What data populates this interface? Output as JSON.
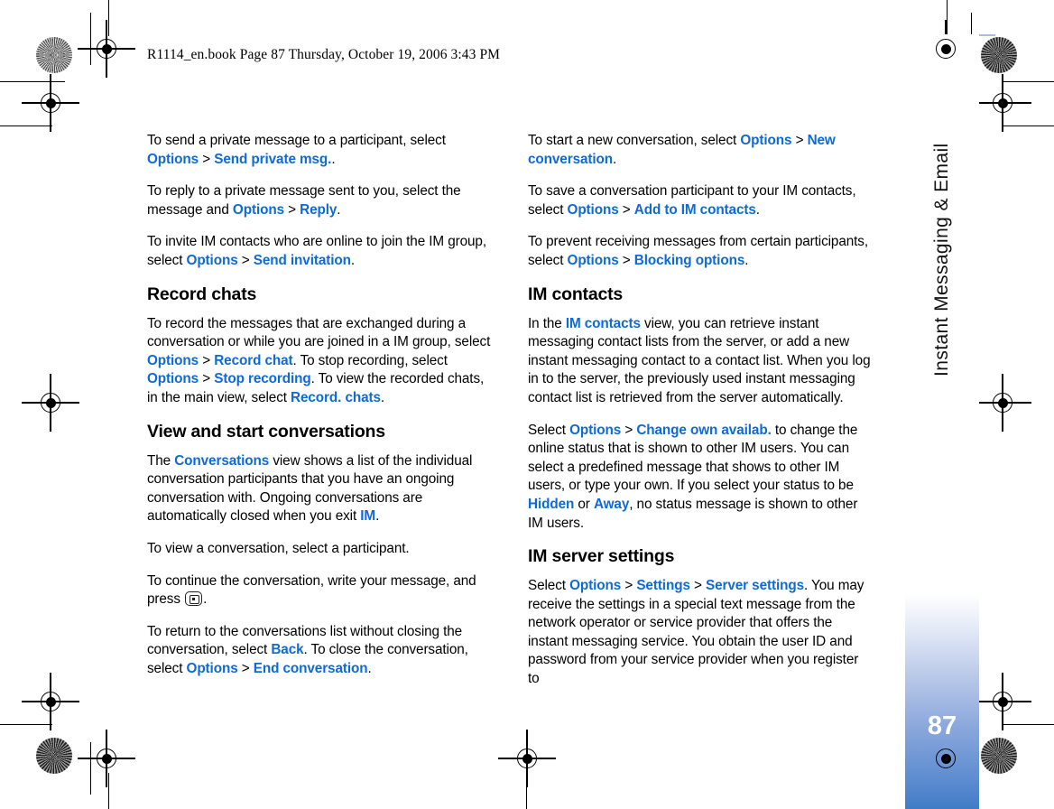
{
  "document": {
    "header_line": "R1114_en.book  Page 87  Thursday, October 19, 2006  3:43 PM",
    "page_number": "87",
    "chapter_title": "Instant Messaging & Email",
    "accent_color": "#0e6ad8",
    "sidebar_gradient_end": "#3f7cc6"
  },
  "left_column": {
    "blocks": [
      {
        "type": "paragraph",
        "runs": [
          {
            "t": "To send a private message to a participant, select ",
            "s": "plain"
          },
          {
            "t": "Options",
            "s": "ui"
          },
          {
            "t": " > ",
            "s": "sep"
          },
          {
            "t": "Send private msg.",
            "s": "ui"
          },
          {
            "t": ".",
            "s": "plain"
          }
        ]
      },
      {
        "type": "paragraph",
        "runs": [
          {
            "t": "To reply to a private message sent to you, select the message and ",
            "s": "plain"
          },
          {
            "t": "Options",
            "s": "ui"
          },
          {
            "t": " > ",
            "s": "sep"
          },
          {
            "t": "Reply",
            "s": "ui"
          },
          {
            "t": ".",
            "s": "plain"
          }
        ]
      },
      {
        "type": "paragraph",
        "runs": [
          {
            "t": "To invite IM contacts who are online to join the IM group, select ",
            "s": "plain"
          },
          {
            "t": "Options",
            "s": "ui"
          },
          {
            "t": " > ",
            "s": "sep"
          },
          {
            "t": "Send invitation",
            "s": "ui"
          },
          {
            "t": ".",
            "s": "plain"
          }
        ]
      },
      {
        "type": "heading",
        "text": "Record chats"
      },
      {
        "type": "paragraph",
        "runs": [
          {
            "t": "To record the messages that are exchanged during a conversation or while you are joined in a IM group, select ",
            "s": "plain"
          },
          {
            "t": "Options",
            "s": "ui"
          },
          {
            "t": " > ",
            "s": "sep"
          },
          {
            "t": "Record chat",
            "s": "ui"
          },
          {
            "t": ". To stop recording, select ",
            "s": "plain"
          },
          {
            "t": "Options",
            "s": "ui"
          },
          {
            "t": " > ",
            "s": "sep"
          },
          {
            "t": "Stop recording",
            "s": "ui"
          },
          {
            "t": ". To view the recorded chats, in the main view, select ",
            "s": "plain"
          },
          {
            "t": "Record. chats",
            "s": "ui"
          },
          {
            "t": ".",
            "s": "plain"
          }
        ]
      },
      {
        "type": "heading",
        "text": "View and start conversations"
      },
      {
        "type": "paragraph",
        "runs": [
          {
            "t": "The ",
            "s": "plain"
          },
          {
            "t": "Conversations",
            "s": "ui"
          },
          {
            "t": " view shows a list of the individual conversation participants that you have an ongoing conversation with. Ongoing conversations are automatically closed when you exit ",
            "s": "plain"
          },
          {
            "t": "IM",
            "s": "ui"
          },
          {
            "t": ".",
            "s": "plain"
          }
        ]
      },
      {
        "type": "paragraph",
        "runs": [
          {
            "t": "To view a conversation, select a participant.",
            "s": "plain"
          }
        ]
      },
      {
        "type": "paragraph",
        "runs": [
          {
            "t": "To continue the conversation, write your message, and press ",
            "s": "plain"
          },
          {
            "t": "scroll-key-icon",
            "s": "icon"
          },
          {
            "t": ".",
            "s": "plain"
          }
        ]
      },
      {
        "type": "paragraph",
        "runs": [
          {
            "t": "To return to the conversations list without closing the conversation, select ",
            "s": "plain"
          },
          {
            "t": "Back",
            "s": "ui"
          },
          {
            "t": ". To close the conversation, select ",
            "s": "plain"
          },
          {
            "t": "Options",
            "s": "ui"
          },
          {
            "t": " > ",
            "s": "sep"
          },
          {
            "t": "End conversation",
            "s": "ui"
          },
          {
            "t": ".",
            "s": "plain"
          }
        ]
      }
    ]
  },
  "right_column": {
    "blocks": [
      {
        "type": "paragraph",
        "runs": [
          {
            "t": "To start a new conversation, select ",
            "s": "plain"
          },
          {
            "t": "Options",
            "s": "ui"
          },
          {
            "t": " > ",
            "s": "sep"
          },
          {
            "t": "New conversation",
            "s": "ui"
          },
          {
            "t": ".",
            "s": "plain"
          }
        ]
      },
      {
        "type": "paragraph",
        "runs": [
          {
            "t": "To save a conversation participant to your IM contacts, select ",
            "s": "plain"
          },
          {
            "t": "Options",
            "s": "ui"
          },
          {
            "t": " > ",
            "s": "sep"
          },
          {
            "t": "Add to IM contacts",
            "s": "ui"
          },
          {
            "t": ".",
            "s": "plain"
          }
        ]
      },
      {
        "type": "paragraph",
        "runs": [
          {
            "t": "To prevent receiving messages from certain participants, select ",
            "s": "plain"
          },
          {
            "t": "Options",
            "s": "ui"
          },
          {
            "t": " > ",
            "s": "sep"
          },
          {
            "t": "Blocking options",
            "s": "ui"
          },
          {
            "t": ".",
            "s": "plain"
          }
        ]
      },
      {
        "type": "heading",
        "text": "IM contacts"
      },
      {
        "type": "paragraph",
        "runs": [
          {
            "t": "In the ",
            "s": "plain"
          },
          {
            "t": "IM contacts",
            "s": "ui"
          },
          {
            "t": " view, you can retrieve instant messaging contact lists from the server, or add a new instant messaging contact to a contact list. When you log in to the server, the previously used instant messaging contact list is retrieved from the server automatically.",
            "s": "plain"
          }
        ]
      },
      {
        "type": "paragraph",
        "runs": [
          {
            "t": "Select ",
            "s": "plain"
          },
          {
            "t": "Options",
            "s": "ui"
          },
          {
            "t": " > ",
            "s": "sep"
          },
          {
            "t": "Change own availab.",
            "s": "ui"
          },
          {
            "t": " to change the online status that is shown to other IM users. You can select a predefined message that shows to other IM users, or type your own. If you select your status to be ",
            "s": "plain"
          },
          {
            "t": "Hidden",
            "s": "ui"
          },
          {
            "t": " or ",
            "s": "plain"
          },
          {
            "t": "Away",
            "s": "ui"
          },
          {
            "t": ", no status message is shown to other IM users.",
            "s": "plain"
          }
        ]
      },
      {
        "type": "heading",
        "text": "IM server settings"
      },
      {
        "type": "paragraph",
        "runs": [
          {
            "t": "Select ",
            "s": "plain"
          },
          {
            "t": "Options",
            "s": "ui"
          },
          {
            "t": " > ",
            "s": "sep"
          },
          {
            "t": "Settings",
            "s": "ui"
          },
          {
            "t": " > ",
            "s": "sep"
          },
          {
            "t": "Server settings",
            "s": "ui"
          },
          {
            "t": ". You may receive the settings in a special text message from the network operator or service provider that offers the instant messaging service. You obtain the user ID and password from your service provider when you register to",
            "s": "plain"
          }
        ]
      }
    ]
  }
}
